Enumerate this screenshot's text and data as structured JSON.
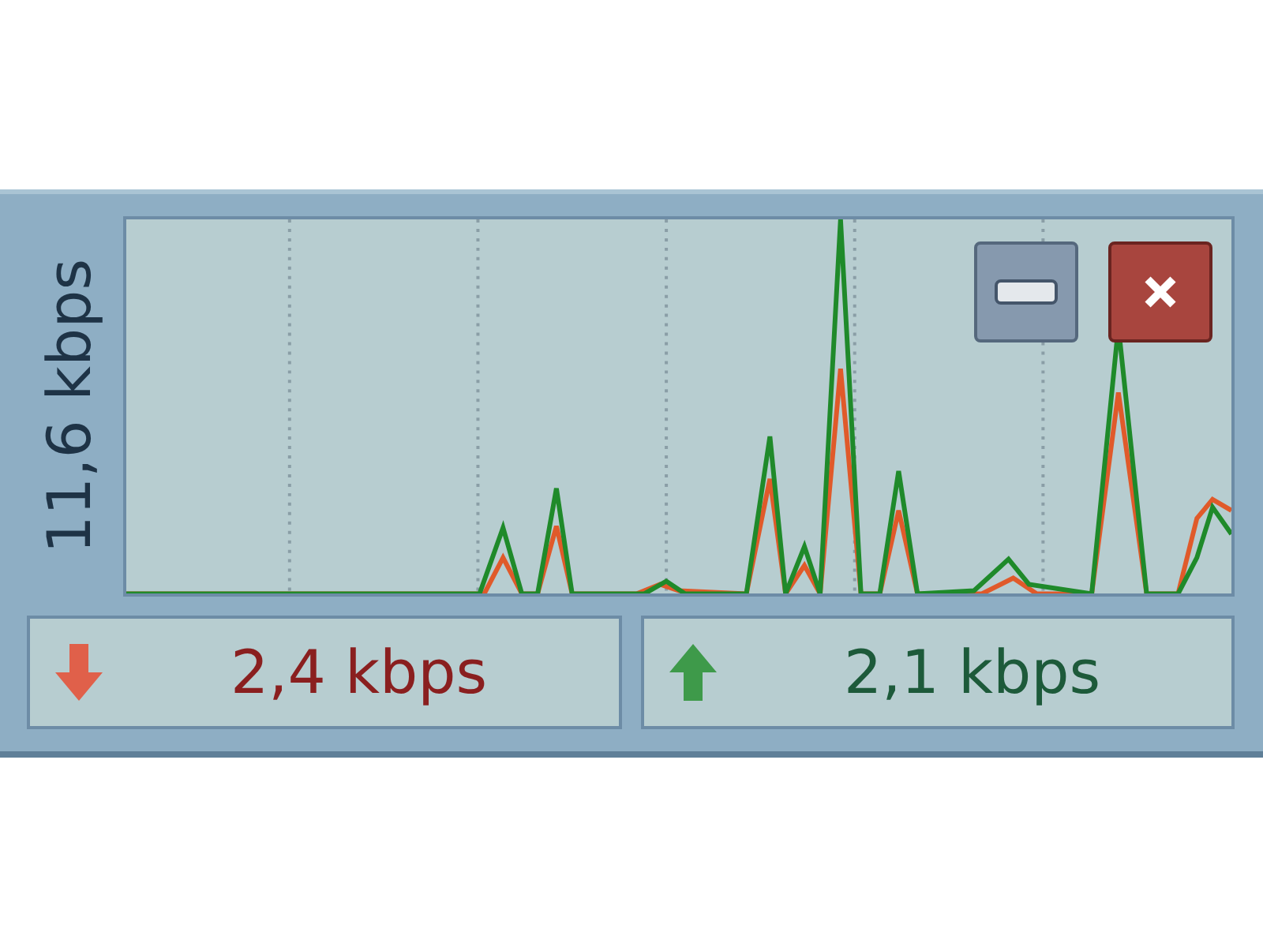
{
  "scale_label": "11,6 kbps",
  "rates": [
    {
      "kind": "download",
      "reading": "2,4 kbps"
    },
    {
      "kind": "upload",
      "reading": "2,1 kbps"
    }
  ]
}
